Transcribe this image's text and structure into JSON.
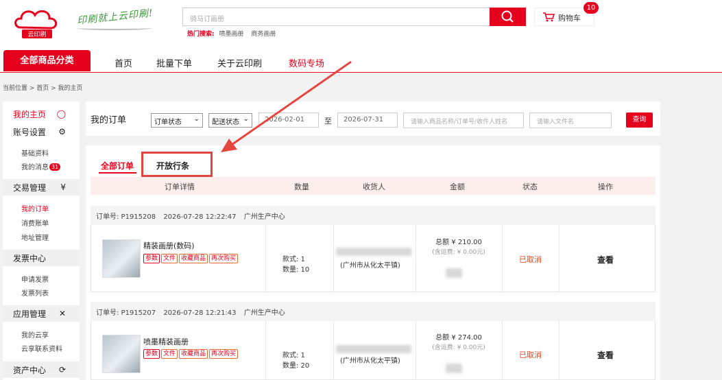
{
  "header": {
    "logo_text": "云印刷",
    "slogan": "印刷就上云印刷!",
    "search_placeholder": "骑马订画册",
    "hot_label": "热门搜索:",
    "hot_items": [
      "喷墨画册",
      "商务画册"
    ],
    "cart_label": "购物车",
    "cart_count": "10"
  },
  "nav": {
    "all_categories": "全部商品分类",
    "items": [
      "首页",
      "批量下单",
      "关于云印刷",
      "数码专场"
    ]
  },
  "breadcrumb": "当前位置 > 首页 > 我的主页",
  "sidebar": {
    "my_home": "我的主页",
    "account_settings": "账号设置",
    "basic_info": "基础资料",
    "my_messages": "我的消息",
    "messages_badge": "31",
    "trade_management": "交易管理",
    "my_orders": "我的订单",
    "consumption_bill": "消费账单",
    "address_management": "地址管理",
    "invoice_center": "发票中心",
    "apply_invoice": "申请发票",
    "invoice_list": "发票列表",
    "app_management": "应用管理",
    "my_cloud_share": "我的云享",
    "cloud_contacts": "云享联系资料",
    "asset_center": "资产中心"
  },
  "filter": {
    "title": "我的订单",
    "order_status": "订单状态",
    "delivery_status": "配送状态",
    "date_from": "2026-02-01",
    "to_label": "至",
    "date_to": "2026-07-31",
    "keyword_placeholder": "请输入商品名称/订单号/收件人姓名",
    "filename_placeholder": "请输入文件名",
    "query_button": "查询"
  },
  "tabs": [
    "全部订单",
    "开放行条"
  ],
  "table_headers": [
    "订单详情",
    "数量",
    "收货人",
    "金额",
    "状态",
    "操作"
  ],
  "orders": [
    {
      "order_no": "订单号: P1915208",
      "time": "2026-07-28 12:22:47",
      "center": "广州生产中心",
      "product": "精装画册(数码)",
      "tags": [
        "参数",
        "文件",
        "收藏商品",
        "再次购买"
      ],
      "styles": "款式: 1",
      "quantity": "数量: 10",
      "address": "(广州市从化太平镇)",
      "total": "总额 ¥ 210.00",
      "tax": "(含运费: ¥ 0.00元)",
      "status": "已取消",
      "action": "查看"
    },
    {
      "order_no": "订单号: P1915207",
      "time": "2026-07-28 12:21:43",
      "center": "广州生产中心",
      "product": "喷墨精装画册",
      "tags": [
        "参数",
        "文件",
        "收藏商品",
        "再次购买"
      ],
      "styles": "款式: 1",
      "quantity": "数量: 20",
      "address": "(广州市从化太平镇)",
      "total": "总额 ¥ 274.00",
      "tax": "(含运费: ¥ 0.00元)",
      "status": "已取消",
      "action": "查看"
    }
  ],
  "colors": {
    "brand": "#e5001e",
    "annotation": "#e5453f",
    "status_cancelled": "#e5451e"
  }
}
